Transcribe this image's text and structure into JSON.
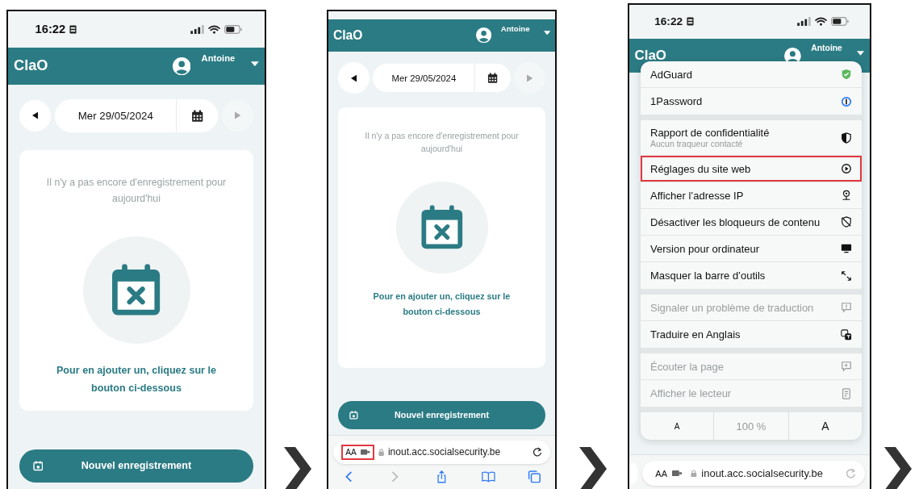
{
  "screens": [
    {
      "kind": "app",
      "status_bar": {
        "time": "16:22"
      },
      "app_title": "ClaO",
      "user_name": "Antoine",
      "date": "Mer 29/05/2024",
      "empty_message": "Il n'y a pas encore d'enregistrement pour aujourd'hui",
      "hint": "Pour en ajouter un, cliquez sur le bouton ci-dessous",
      "new_button": "Nouvel enregistrement"
    },
    {
      "kind": "app_browser",
      "app_title": "ClaO",
      "user_name": "Antoine",
      "date": "Mer 29/05/2024",
      "empty_message": "Il n'y a pas encore d'enregistrement pour aujourd'hui",
      "hint": "Pour en ajouter un, cliquez sur le bouton ci-dessous",
      "new_button": "Nouvel enregistrement",
      "address_bar": {
        "text_size": "AA",
        "url": "inout.acc.socialsecurity.be",
        "highlighted": true
      }
    },
    {
      "kind": "menu",
      "status_bar": {
        "time": "16:22"
      },
      "app_title": "ClaO",
      "user_name": "Antoine",
      "menu": {
        "sections": [
          {
            "items": [
              {
                "label": "AdGuard",
                "kind": "adguard",
                "disabled": false,
                "highlighted": false
              },
              {
                "label": "1Password",
                "kind": "password",
                "disabled": false,
                "highlighted": false
              }
            ]
          },
          {
            "items": [
              {
                "label": "Rapport de confidentialité",
                "subtitle": "Aucun traqueur contacté",
                "kind": "privacy",
                "disabled": false,
                "highlighted": false
              },
              {
                "label": "Réglages du site web",
                "kind": "settings",
                "disabled": false,
                "highlighted": true
              },
              {
                "label": "Afficher l’adresse IP",
                "kind": "ip",
                "disabled": false,
                "highlighted": false
              },
              {
                "label": "Désactiver les bloqueurs de contenu",
                "kind": "blockers",
                "disabled": false,
                "highlighted": false
              },
              {
                "label": "Version pour ordinateur",
                "kind": "desktop",
                "disabled": false,
                "highlighted": false
              },
              {
                "label": "Masquer la barre d’outils",
                "kind": "hide_toolbar",
                "disabled": false,
                "highlighted": false
              }
            ]
          },
          {
            "items": [
              {
                "label": "Signaler un problème de traduction",
                "kind": "report",
                "disabled": true,
                "highlighted": false
              },
              {
                "label": "Traduire en Anglais",
                "kind": "translate",
                "disabled": false,
                "highlighted": false
              }
            ]
          },
          {
            "items": [
              {
                "label": "Écouter la page",
                "kind": "listen",
                "disabled": true,
                "highlighted": false
              },
              {
                "label": "Afficher le lecteur",
                "kind": "reader",
                "disabled": true,
                "highlighted": false
              }
            ]
          }
        ],
        "zoom": {
          "smaller": "A",
          "level": "100 %",
          "larger": "A"
        }
      },
      "address_bar": {
        "text_size": "AA",
        "url": "inout.acc.socialsecurity.be",
        "highlighted": false
      }
    }
  ]
}
